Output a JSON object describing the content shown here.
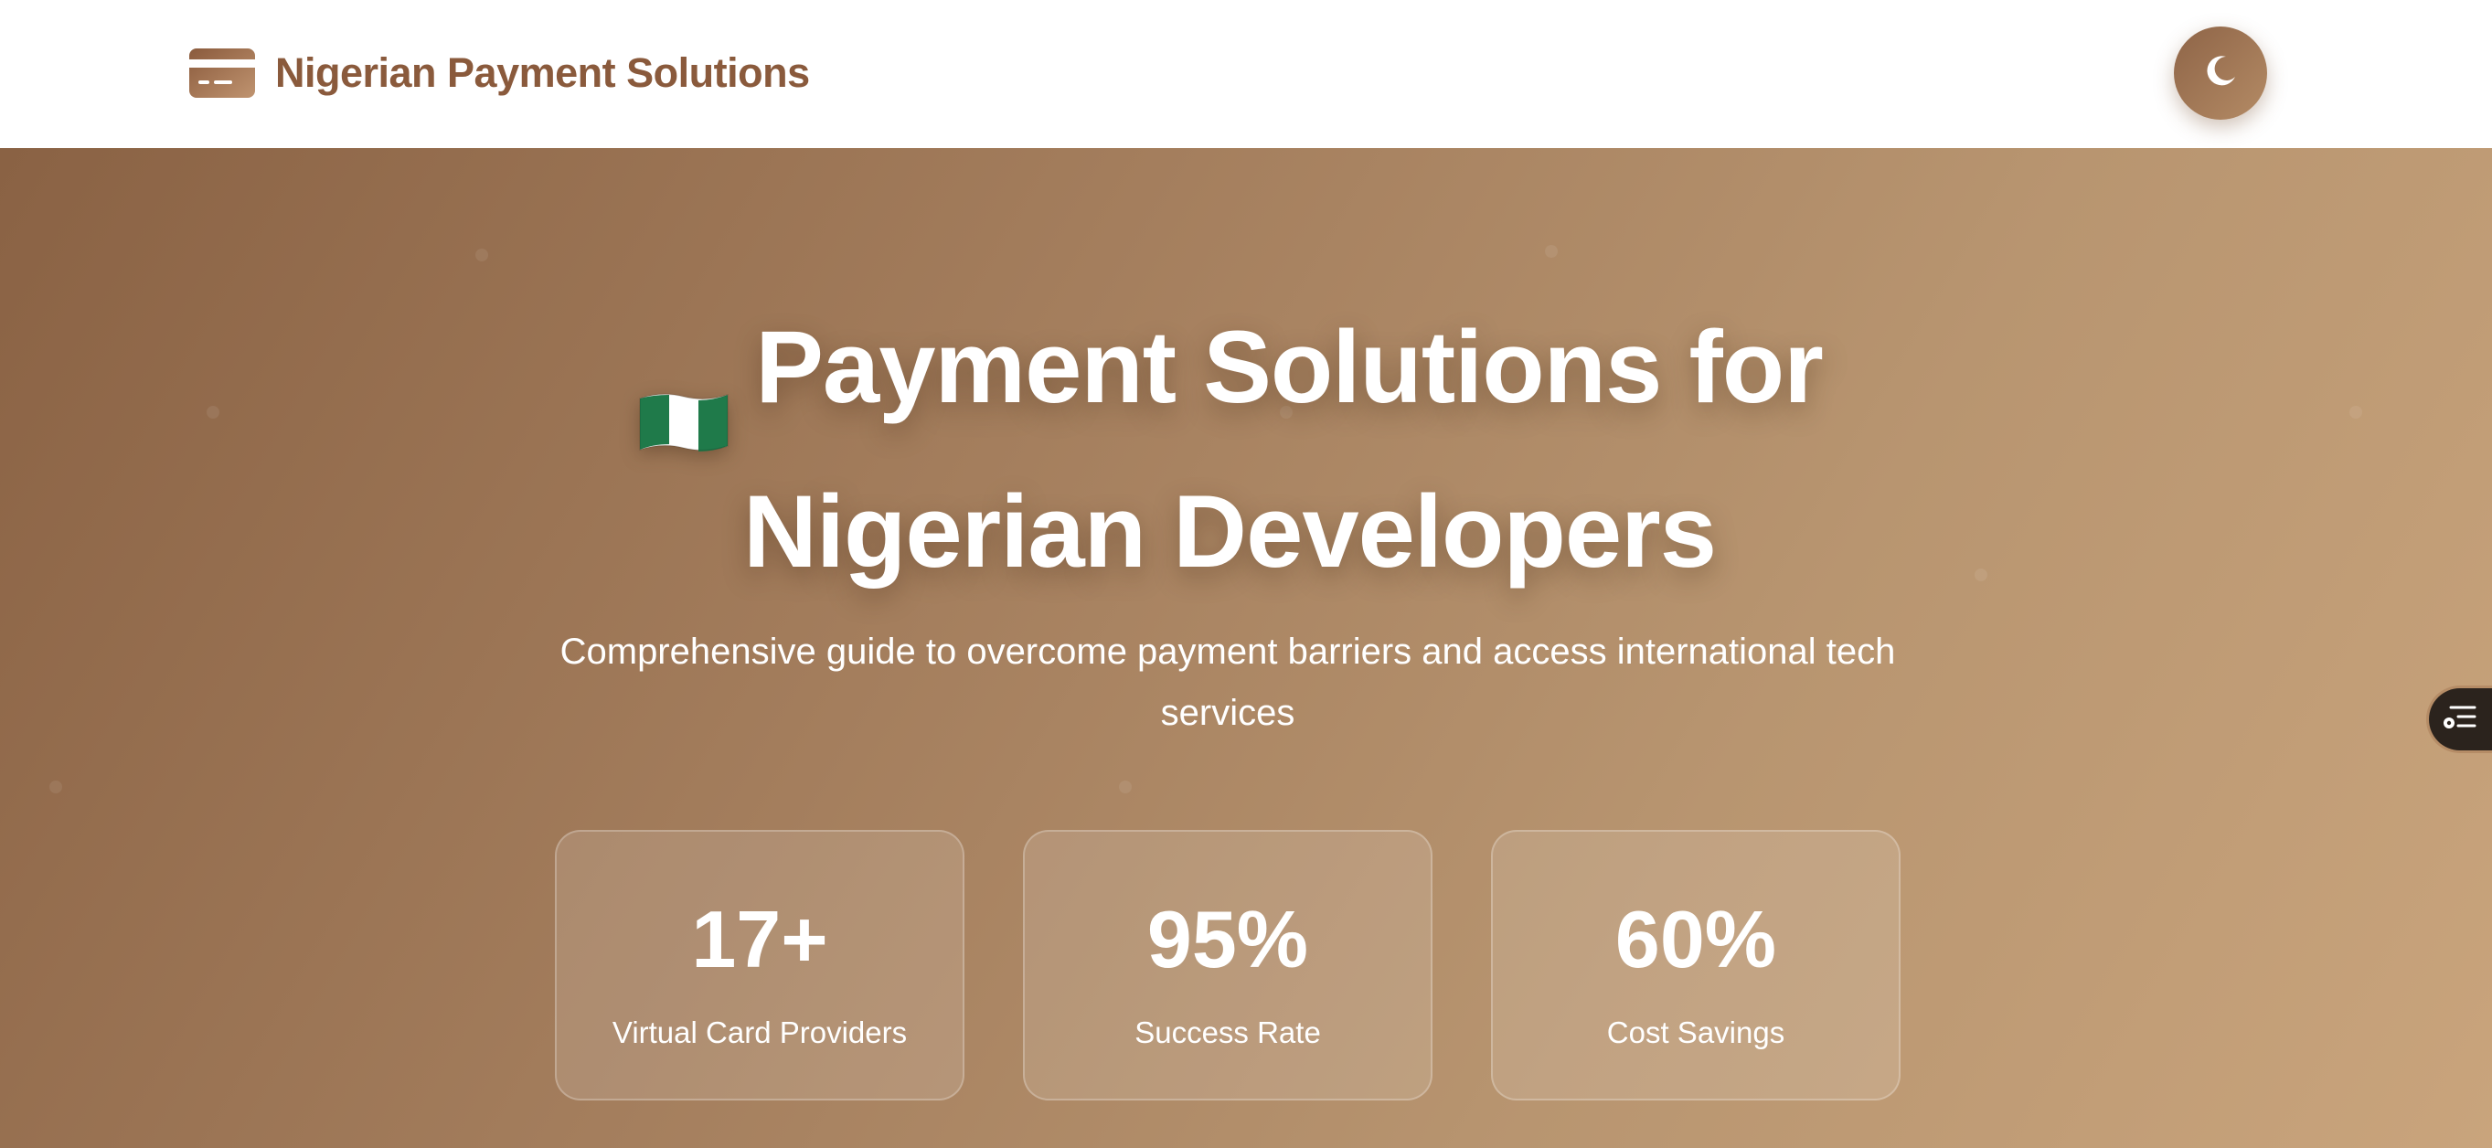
{
  "header": {
    "brand_title": "Nigerian Payment Solutions",
    "brand_icon": "credit-card-icon",
    "theme_toggle_icon": "moon-icon"
  },
  "hero": {
    "flag_icon": "nigeria-flag-icon",
    "title_line1": "Payment Solutions for",
    "title_line2": "Nigerian Developers",
    "subtitle": "Comprehensive guide to overcome payment barriers and access international tech services"
  },
  "stats": [
    {
      "value": "17+",
      "label": "Virtual Card Providers"
    },
    {
      "value": "95%",
      "label": "Success Rate"
    },
    {
      "value": "60%",
      "label": "Cost Savings"
    }
  ],
  "floating": {
    "toc_icon": "table-of-contents-icon"
  },
  "colors": {
    "brand_text": "#8a5a3c",
    "hero_gradient_start": "#8a6244",
    "hero_gradient_end": "#c9a47c",
    "toggle_bg": "#9c7352",
    "toc_bg": "#2b231d",
    "flag_green": "#1f7a4a",
    "text_light": "#ffffff"
  }
}
